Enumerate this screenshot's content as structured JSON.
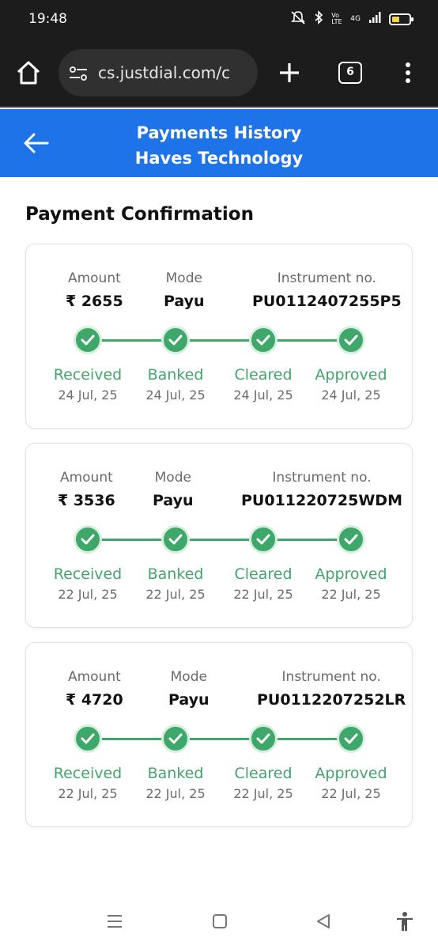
{
  "status_bar": {
    "time": "19:48",
    "network": "4G",
    "volte": "Vo LTE",
    "battery_level": 0.45
  },
  "browser": {
    "url": "cs.justdial.com/c",
    "tab_count": "6"
  },
  "header": {
    "title_line1": "Payments History",
    "title_line2": "Haves Technology"
  },
  "section_title": "Payment Confirmation",
  "labels": {
    "amount": "Amount",
    "mode": "Mode",
    "instrument": "Instrument no."
  },
  "steps": [
    "Received",
    "Banked",
    "Cleared",
    "Approved"
  ],
  "payments": [
    {
      "amount": "₹ 2655",
      "mode": "Payu",
      "instrument": "PU0112407255P5",
      "dates": [
        "24 Jul, 25",
        "24 Jul, 25",
        "24 Jul, 25",
        "24 Jul, 25"
      ]
    },
    {
      "amount": "₹ 3536",
      "mode": "Payu",
      "instrument": "PU011220725WDM",
      "dates": [
        "22 Jul, 25",
        "22 Jul, 25",
        "22 Jul, 25",
        "22 Jul, 25"
      ]
    },
    {
      "amount": "₹ 4720",
      "mode": "Payu",
      "instrument": "PU0112207252LR",
      "dates": [
        "22 Jul, 25",
        "22 Jul, 25",
        "22 Jul, 25",
        "22 Jul, 25"
      ]
    }
  ],
  "colors": {
    "header_bg": "#1e73e8",
    "step_green": "#3da86a",
    "battery": "#f1d64c"
  },
  "nav_icons": [
    "recents-icon",
    "home-square-icon",
    "back-triangle-icon",
    "accessibility-icon"
  ]
}
